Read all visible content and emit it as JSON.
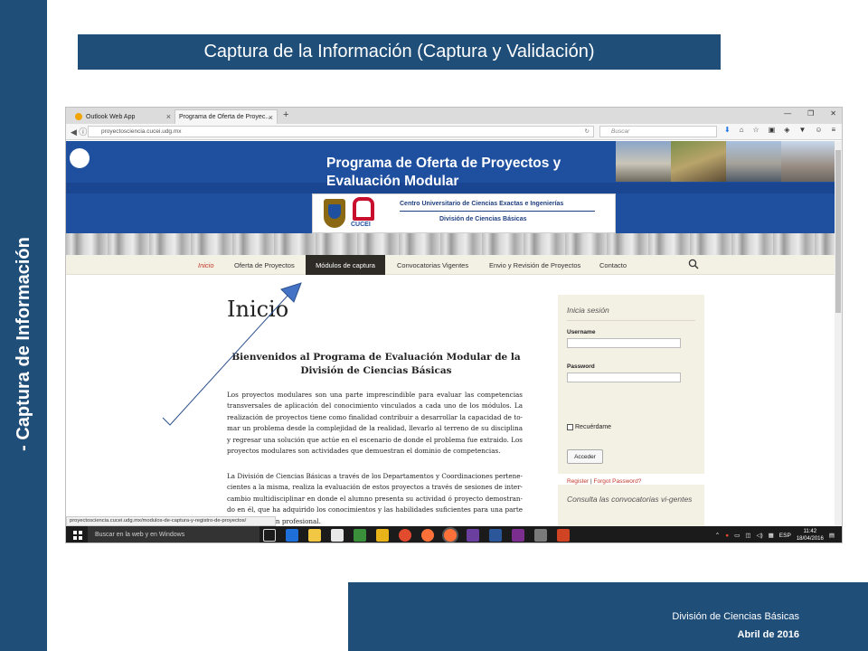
{
  "slide": {
    "side_label": "- Captura de Información",
    "title": "Captura de la Información (Captura y Validación)",
    "footer_line1": "División de Ciencias Básicas",
    "footer_line2": "Abril de 2016",
    "accent": "#1f4e79"
  },
  "browser": {
    "tabs": [
      {
        "label": "Outlook Web App",
        "icon": "outlook-icon"
      },
      {
        "label": "Programa de Oferta de Proyec...",
        "icon": "page-icon"
      }
    ],
    "new_tab": "+",
    "url": "proyectosciencia.cucei.udg.mx",
    "search_placeholder": "Buscar",
    "status_url": "proyectosciencia.cucei.udg.mx/modulos-de-captura-y-registro-de-proyectos/"
  },
  "site": {
    "banner_title_1": "Programa de Oferta de Proyectos y",
    "banner_title_2": "Evaluación Modular",
    "center_name": "Centro Universitario de Ciencias Exactas e Ingenierías",
    "division_name": "División de Ciencias Básicas",
    "cucei_label": "CUCEI",
    "brand_color": "#1f50a0",
    "menu": [
      {
        "label": "Inicio",
        "state": "current"
      },
      {
        "label": "Oferta de Proyectos",
        "state": "normal"
      },
      {
        "label": "Módulos de captura",
        "state": "selected"
      },
      {
        "label": "Convocatorias Vigentes",
        "state": "normal"
      },
      {
        "label": "Envio y Revisión de Proyectos",
        "state": "normal"
      },
      {
        "label": "Contacto",
        "state": "normal"
      }
    ],
    "page_title": "Inicio",
    "welcome_heading": "Bienvenidos al Programa de Evaluación Modular de la División de Ciencias Básicas",
    "paragraph_1": "Los proyectos modulares son una parte imprescindible para evaluar las competencias transversales de aplicación del conocimiento vinculados a cada uno de los módulos. La realización de proyectos tiene como finalidad contribuir a desarrollar la capacidad de to-mar un problema desde la complejidad de la realidad, llevarlo al terreno de su disciplina y regresar una solución que actúe en el escenario de donde el problema fue extraido. Los proyectos modulares son actividades que demuestran el dominio de competencias.",
    "paragraph_2": "La División de Ciencias Básicas a través de los Departamentos y Coordinaciones pertene-cientes a la misma, realiza la evaluación de estos proyectos a través de sesiones de inter-cambio multidisciplinar en donde el alumno presenta su actividad ó proyecto demostran-do en él, que ha adquirido los conocimientos y las habilidades suficientes para una parte de su formación profesional.",
    "login": {
      "title": "Inicia sesión",
      "username_label": "Username",
      "password_label": "Password",
      "remember_label": "Recuérdame",
      "submit_label": "Acceder",
      "register_link": "Register",
      "separator": "|",
      "forgot_link": "Forgot Password?"
    },
    "convocatorias_title": "Consulta las convocatorias vi-gentes"
  },
  "taskbar": {
    "search_placeholder": "Buscar en la web y en Windows",
    "language": "ESP",
    "time": "11:42",
    "date": "18/04/2016"
  },
  "annotation": {
    "arrow_color": "#4472c4"
  }
}
